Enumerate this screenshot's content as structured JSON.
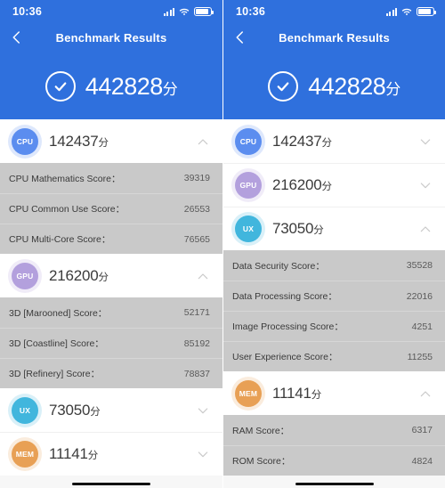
{
  "status_bar": {
    "time": "10:36",
    "signal_icon": "cellular-signal-icon",
    "wifi_icon": "wifi-icon",
    "battery_icon": "battery-icon"
  },
  "nav": {
    "title": "Benchmark Results",
    "back_icon": "back-chevron-icon"
  },
  "summary": {
    "total_score": "442828",
    "unit": "分",
    "check_icon": "check-circle-icon"
  },
  "colors": {
    "header_blue": "#2f70dd",
    "cpu": "#5b8def",
    "gpu": "#b3a0dd",
    "ux": "#41b6dd",
    "mem": "#e8a055",
    "subrow_bg": "#c9c9c9"
  },
  "panels": [
    {
      "id": "left-panel",
      "categories": [
        {
          "key": "cpu",
          "badge": "CPU",
          "score": "142437",
          "unit": "分",
          "expanded": true,
          "chevron": "chevron-up-icon",
          "rows": [
            {
              "label": "CPU Mathematics Score：",
              "value": "39319"
            },
            {
              "label": "CPU Common Use Score：",
              "value": "26553"
            },
            {
              "label": "CPU Multi-Core Score：",
              "value": "76565"
            }
          ]
        },
        {
          "key": "gpu",
          "badge": "GPU",
          "score": "216200",
          "unit": "分",
          "expanded": true,
          "chevron": "chevron-up-icon",
          "rows": [
            {
              "label": "3D [Marooned] Score：",
              "value": "52171"
            },
            {
              "label": "3D [Coastline] Score：",
              "value": "85192"
            },
            {
              "label": "3D [Refinery] Score：",
              "value": "78837"
            }
          ]
        },
        {
          "key": "ux",
          "badge": "UX",
          "score": "73050",
          "unit": "分",
          "expanded": false,
          "chevron": "chevron-down-icon",
          "rows": []
        },
        {
          "key": "mem",
          "badge": "MEM",
          "score": "11141",
          "unit": "分",
          "expanded": false,
          "chevron": "chevron-down-icon",
          "rows": []
        }
      ]
    },
    {
      "id": "right-panel",
      "categories": [
        {
          "key": "cpu",
          "badge": "CPU",
          "score": "142437",
          "unit": "分",
          "expanded": false,
          "chevron": "chevron-down-icon",
          "rows": []
        },
        {
          "key": "gpu",
          "badge": "GPU",
          "score": "216200",
          "unit": "分",
          "expanded": false,
          "chevron": "chevron-down-icon",
          "rows": []
        },
        {
          "key": "ux",
          "badge": "UX",
          "score": "73050",
          "unit": "分",
          "expanded": true,
          "chevron": "chevron-up-icon",
          "rows": [
            {
              "label": "Data Security Score：",
              "value": "35528"
            },
            {
              "label": "Data Processing Score：",
              "value": "22016"
            },
            {
              "label": "Image Processing Score：",
              "value": "4251"
            },
            {
              "label": "User Experience Score：",
              "value": "11255"
            }
          ]
        },
        {
          "key": "mem",
          "badge": "MEM",
          "score": "11141",
          "unit": "分",
          "expanded": true,
          "chevron": "chevron-up-icon",
          "rows": [
            {
              "label": "RAM Score：",
              "value": "6317"
            },
            {
              "label": "ROM Score：",
              "value": "4824"
            }
          ]
        }
      ]
    }
  ]
}
